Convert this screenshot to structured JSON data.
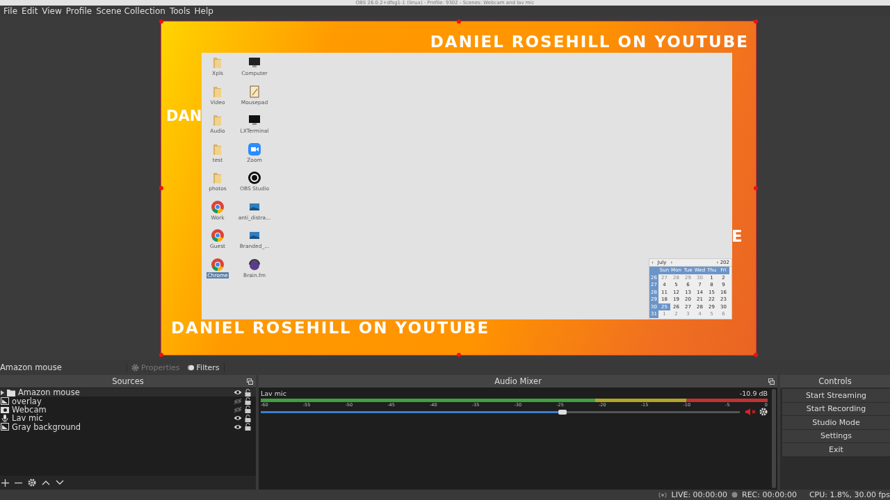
{
  "window": {
    "title": "OBS 26.0.2+dfsg1-1 (linux) - Profile: 9302 - Scenes: Webcam and lav mic"
  },
  "menu": [
    "File",
    "Edit",
    "View",
    "Profile",
    "Scene Collection",
    "Tools",
    "Help"
  ],
  "preview": {
    "banners": [
      {
        "text": "DANIEL ROSEHILL ON YOUTUBE",
        "kind": "top"
      },
      {
        "text": "DAN",
        "kind": "left"
      },
      {
        "text": "E",
        "kind": "right"
      },
      {
        "text": "DANIEL ROSEHILL ON YOUTUBE",
        "kind": "bottom"
      }
    ],
    "desktop_icons": [
      {
        "label": "Xpls",
        "kind": "folder",
        "selected": false
      },
      {
        "label": "Computer",
        "kind": "monitor",
        "selected": false
      },
      {
        "label": "Video",
        "kind": "folder",
        "selected": false
      },
      {
        "label": "Mousepad",
        "kind": "notepad",
        "selected": false
      },
      {
        "label": "Audio",
        "kind": "folder",
        "selected": false
      },
      {
        "label": "LXTerminal",
        "kind": "terminal",
        "selected": false
      },
      {
        "label": "test",
        "kind": "folder",
        "selected": false
      },
      {
        "label": "Zoom",
        "kind": "videocam",
        "selected": false
      },
      {
        "label": "photos",
        "kind": "folder",
        "selected": false
      },
      {
        "label": "OBS Studio",
        "kind": "obs",
        "selected": false
      },
      {
        "label": "Work",
        "kind": "browser",
        "selected": false
      },
      {
        "label": "anti_distra...",
        "kind": "image",
        "selected": false
      },
      {
        "label": "Guest",
        "kind": "browser",
        "selected": false
      },
      {
        "label": "Branded_...",
        "kind": "image",
        "selected": false
      },
      {
        "label": "Chrome",
        "kind": "browser",
        "selected": true
      },
      {
        "label": "Brain.fm",
        "kind": "headphones",
        "selected": false
      }
    ],
    "calendar": {
      "month": "July",
      "prev": "‹",
      "next": "›",
      "year": "‹ 202",
      "weekdays": [
        "Sun",
        "Mon",
        "Tue",
        "Wed",
        "Thu",
        "Fri"
      ],
      "weeks": [
        {
          "number": "26",
          "days": [
            {
              "day": "27",
              "dim": true,
              "selected": false
            },
            {
              "day": "28",
              "dim": true,
              "selected": false
            },
            {
              "day": "29",
              "dim": true,
              "selected": false
            },
            {
              "day": "30",
              "dim": true,
              "selected": false
            },
            {
              "day": "1",
              "dim": false,
              "selected": false
            },
            {
              "day": "2",
              "dim": false,
              "selected": false
            }
          ]
        },
        {
          "number": "27",
          "days": [
            {
              "day": "4",
              "dim": false,
              "selected": false
            },
            {
              "day": "5",
              "dim": false,
              "selected": false
            },
            {
              "day": "6",
              "dim": false,
              "selected": false
            },
            {
              "day": "7",
              "dim": false,
              "selected": false
            },
            {
              "day": "8",
              "dim": false,
              "selected": false
            },
            {
              "day": "9",
              "dim": false,
              "selected": false
            }
          ]
        },
        {
          "number": "28",
          "days": [
            {
              "day": "11",
              "dim": false,
              "selected": false
            },
            {
              "day": "12",
              "dim": false,
              "selected": false
            },
            {
              "day": "13",
              "dim": false,
              "selected": false
            },
            {
              "day": "14",
              "dim": false,
              "selected": false
            },
            {
              "day": "15",
              "dim": false,
              "selected": false
            },
            {
              "day": "16",
              "dim": false,
              "selected": false
            }
          ]
        },
        {
          "number": "29",
          "days": [
            {
              "day": "18",
              "dim": false,
              "selected": false
            },
            {
              "day": "19",
              "dim": false,
              "selected": false
            },
            {
              "day": "20",
              "dim": false,
              "selected": false
            },
            {
              "day": "21",
              "dim": false,
              "selected": false
            },
            {
              "day": "22",
              "dim": false,
              "selected": false
            },
            {
              "day": "23",
              "dim": false,
              "selected": false
            }
          ]
        },
        {
          "number": "30",
          "days": [
            {
              "day": "25",
              "dim": false,
              "selected": true
            },
            {
              "day": "26",
              "dim": false,
              "selected": false
            },
            {
              "day": "27",
              "dim": false,
              "selected": false
            },
            {
              "day": "28",
              "dim": false,
              "selected": false
            },
            {
              "day": "29",
              "dim": false,
              "selected": false
            },
            {
              "day": "30",
              "dim": false,
              "selected": false
            }
          ]
        },
        {
          "number": "31",
          "days": [
            {
              "day": "1",
              "dim": true,
              "selected": false
            },
            {
              "day": "2",
              "dim": true,
              "selected": false
            },
            {
              "day": "3",
              "dim": true,
              "selected": false
            },
            {
              "day": "4",
              "dim": true,
              "selected": false
            },
            {
              "day": "5",
              "dim": true,
              "selected": false
            },
            {
              "day": "6",
              "dim": true,
              "selected": false
            }
          ]
        }
      ]
    }
  },
  "source_toolbar": {
    "source": "Amazon mouse",
    "properties": {
      "label": "Properties",
      "disabled": true
    },
    "filters": {
      "label": "Filters",
      "disabled": false
    }
  },
  "sources": {
    "title": "Sources",
    "items": [
      {
        "name": "Amazon mouse",
        "kind": "group",
        "visible": true,
        "selected": true
      },
      {
        "name": "overlay",
        "kind": "image",
        "visible": false,
        "selected": false
      },
      {
        "name": "Webcam",
        "kind": "camera",
        "visible": false,
        "selected": false
      },
      {
        "name": "Lav mic",
        "kind": "mic",
        "visible": true,
        "selected": false
      },
      {
        "name": "Gray background",
        "kind": "image",
        "visible": true,
        "selected": false
      }
    ]
  },
  "audio_mixer": {
    "title": "Audio Mixer",
    "channels": [
      {
        "name": "Lav mic",
        "reading": "-10.9 dB",
        "level": 0.63,
        "muted": true,
        "ticks": [
          "-60",
          "-55",
          "-50",
          "-45",
          "-40",
          "-35",
          "-30",
          "-25",
          "-20",
          "-15",
          "-10",
          "-5",
          "0"
        ]
      }
    ]
  },
  "controls": {
    "title": "Controls",
    "buttons": [
      "Start Streaming",
      "Start Recording",
      "Studio Mode",
      "Settings",
      "Exit"
    ]
  },
  "status_bar": {
    "live": "LIVE: 00:00:00",
    "rec": "REC: 00:00:00",
    "cpu": "CPU: 1.8%, 30.00 fps"
  }
}
